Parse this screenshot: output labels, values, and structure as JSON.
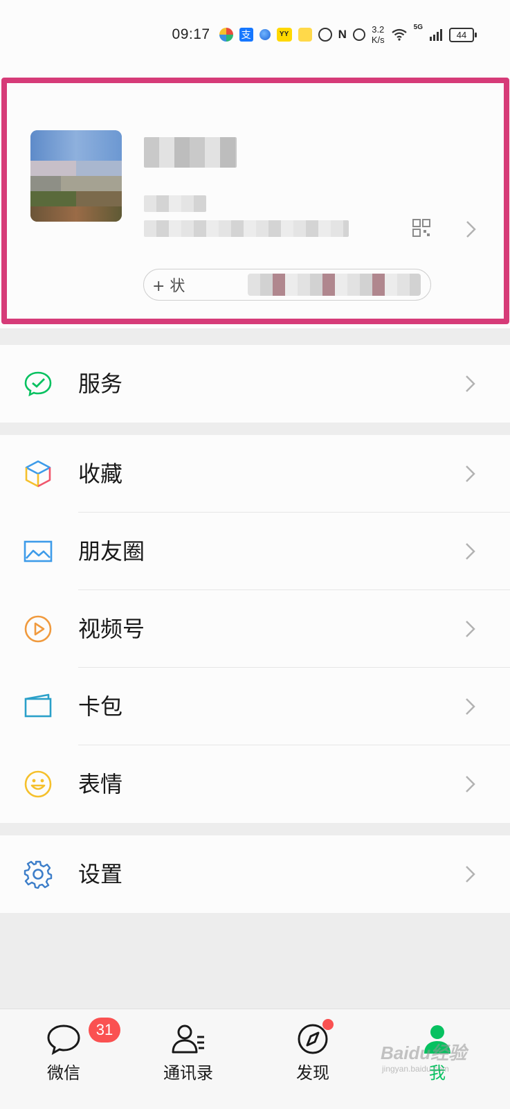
{
  "status_bar": {
    "time": "09:17",
    "net_speed_value": "3.2",
    "net_speed_unit": "K/s",
    "network": "5G",
    "battery": "44"
  },
  "profile": {
    "status_button_label": "+ 状"
  },
  "menu": {
    "service": "服务",
    "favorites": "收藏",
    "moments": "朋友圈",
    "channels": "视频号",
    "card_wallet": "卡包",
    "stickers": "表情",
    "settings": "设置"
  },
  "tabbar": {
    "chats": "微信",
    "chats_badge": "31",
    "contacts": "通讯录",
    "discover": "发现",
    "me": "我"
  },
  "watermark": {
    "text": "Baidu经验",
    "sub": "jingyan.baidu.com"
  },
  "colors": {
    "accent_green": "#07c160",
    "highlight_border": "#d63b78",
    "badge_red": "#fa5151"
  },
  "icons": {
    "service": "service-check-icon",
    "favorites": "cube-icon",
    "moments": "picture-icon",
    "channels": "play-circle-icon",
    "card_wallet": "card-icon",
    "stickers": "smiley-icon",
    "settings": "gear-icon"
  }
}
